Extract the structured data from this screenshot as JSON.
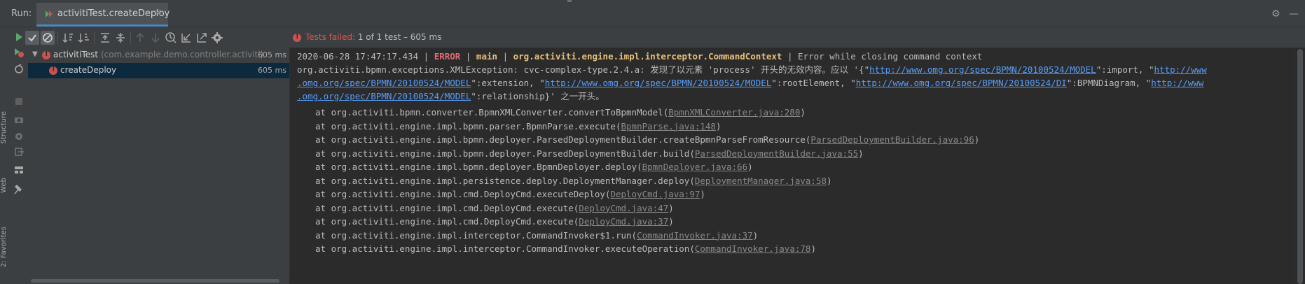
{
  "window": {
    "run_label": "Run:",
    "run_tab_label": "activitiTest.createDeploy",
    "close_glyph": "×",
    "settings_glyph": "⚙",
    "minimize_glyph": "—"
  },
  "left_strip": {
    "labels": [
      "Structure",
      "Web",
      "2: Favorites"
    ]
  },
  "toolbar": {
    "icons": [
      "rerun-icon",
      "show-passed-icon",
      "show-ignored-icon",
      "sort-alpha-icon",
      "sort-duration-icon",
      "expand-all-icon",
      "collapse-all-icon",
      "previous-failed-icon",
      "next-failed-icon",
      "test-history-icon",
      "import-tests-icon",
      "export-tests-icon",
      "settings-icon"
    ]
  },
  "status": {
    "failed_text": "Tests failed:",
    "count_text": "1 of 1 test – 605 ms"
  },
  "tree": {
    "root": {
      "name": "activitiTest",
      "package": "(com.example.demo.controller.activiti)",
      "time": "605 ms"
    },
    "child": {
      "name": "createDeploy",
      "time": "605 ms"
    }
  },
  "console": {
    "log_prefix": "2020-06-28 17:47:17.434 |",
    "level": "ERROR",
    "sep1": "|",
    "thread": "main",
    "sep2": "|",
    "logger": "org.activiti.engine.impl.interceptor.CommandContext",
    "sep3": "|",
    "message": "Error while closing command context",
    "exception_head": "org.activiti.bpmn.exceptions.XMLException: cvc-complex-type.2.4.a: 发现了以元素 'process' 开头的无效内容。应以 '{\"",
    "url1": "http://www.omg.org/spec/BPMN/20100524/MODEL",
    "mid1": "\":import, \"",
    "url2a": "http://www",
    "url2b": ".omg.org/spec/BPMN/20100524/MODEL",
    "mid2": "\":extension, \"",
    "url3": "http://www.omg.org/spec/BPMN/20100524/MODEL",
    "mid3": "\":rootElement, \"",
    "url4": "http://www.omg.org/spec/BPMN/20100524/DI",
    "mid4": "\":BPMNDiagram, \"",
    "url5a": "http://www",
    "url5b": ".omg.org/spec/BPMN/20100524/MODEL",
    "tail": "\":relationship}' 之一开头。",
    "stack": [
      {
        "method": "at org.activiti.bpmn.converter.BpmnXMLConverter.convertToBpmnModel(",
        "source": "BpmnXMLConverter.java:280",
        "end": ")"
      },
      {
        "method": "at org.activiti.engine.impl.bpmn.parser.BpmnParse.execute(",
        "source": "BpmnParse.java:148",
        "end": ")"
      },
      {
        "method": "at org.activiti.engine.impl.bpmn.deployer.ParsedDeploymentBuilder.createBpmnParseFromResource(",
        "source": "ParsedDeploymentBuilder.java:96",
        "end": ")"
      },
      {
        "method": "at org.activiti.engine.impl.bpmn.deployer.ParsedDeploymentBuilder.build(",
        "source": "ParsedDeploymentBuilder.java:55",
        "end": ")"
      },
      {
        "method": "at org.activiti.engine.impl.bpmn.deployer.BpmnDeployer.deploy(",
        "source": "BpmnDeployer.java:66",
        "end": ")"
      },
      {
        "method": "at org.activiti.engine.impl.persistence.deploy.DeploymentManager.deploy(",
        "source": "DeploymentManager.java:58",
        "end": ")"
      },
      {
        "method": "at org.activiti.engine.impl.cmd.DeployCmd.executeDeploy(",
        "source": "DeployCmd.java:97",
        "end": ")"
      },
      {
        "method": "at org.activiti.engine.impl.cmd.DeployCmd.execute(",
        "source": "DeployCmd.java:47",
        "end": ")"
      },
      {
        "method": "at org.activiti.engine.impl.cmd.DeployCmd.execute(",
        "source": "DeployCmd.java:37",
        "end": ")"
      },
      {
        "method": "at org.activiti.engine.impl.interceptor.CommandInvoker$1.run(",
        "source": "CommandInvoker.java:37",
        "end": ")"
      },
      {
        "method": "at org.activiti.engine.impl.interceptor.CommandInvoker.executeOperation(",
        "source": "CommandInvoker.java:78",
        "end": ")"
      }
    ]
  },
  "colors": {
    "background": "#2b2b2b",
    "panel": "#3c3f41",
    "error": "#e0514c",
    "link": "#589df6",
    "selection": "#0d293e"
  }
}
